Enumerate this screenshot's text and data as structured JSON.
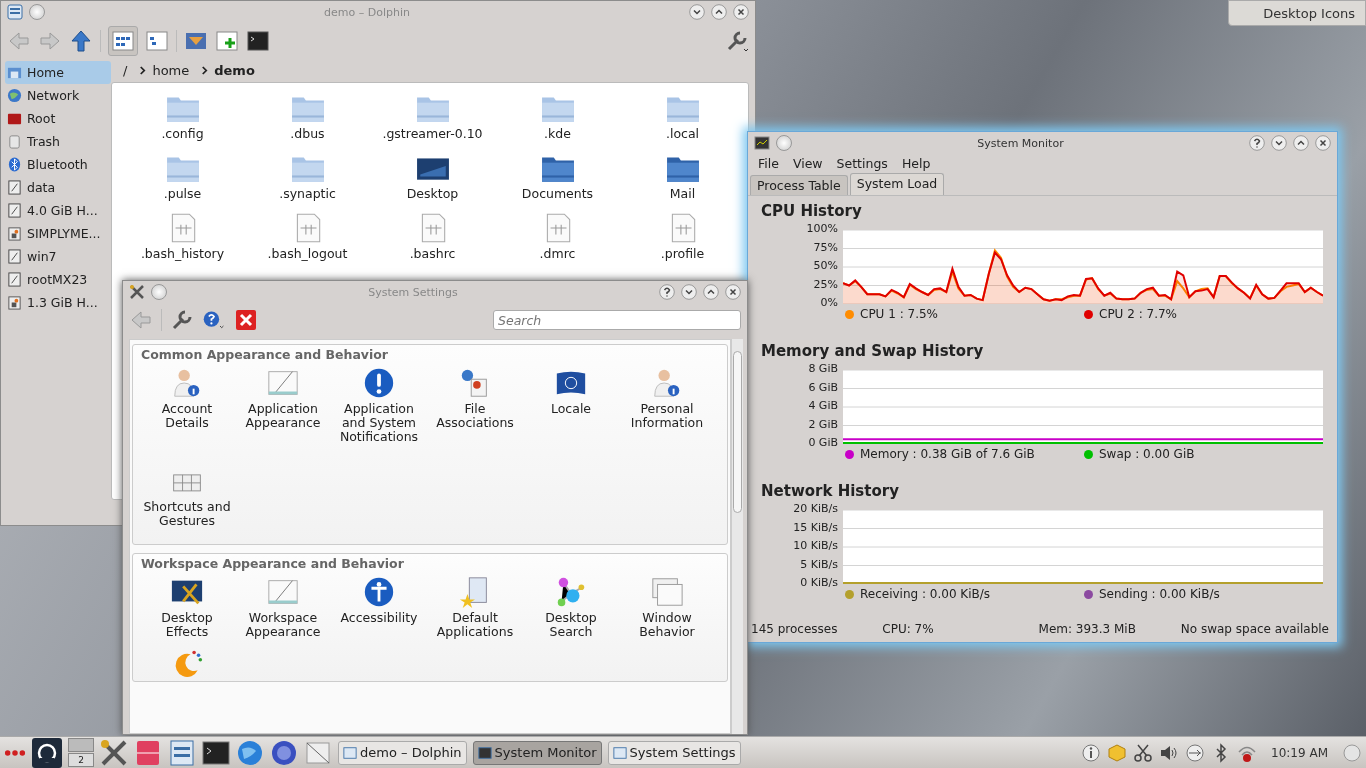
{
  "desktop_button": {
    "label": "Desktop Icons"
  },
  "dolphin": {
    "title": "demo – Dolphin",
    "breadcrumb": [
      {
        "label": "/",
        "current": false
      },
      {
        "label": "home",
        "current": false
      },
      {
        "label": "demo",
        "current": true
      }
    ],
    "places": [
      {
        "label": "Home",
        "selected": true
      },
      {
        "label": "Network",
        "selected": false
      },
      {
        "label": "Root",
        "selected": false
      },
      {
        "label": "Trash",
        "selected": false
      },
      {
        "label": "Bluetooth",
        "selected": false
      },
      {
        "label": "data",
        "selected": false
      },
      {
        "label": "4.0 GiB H...",
        "selected": false
      },
      {
        "label": "SIMPLYME...",
        "selected": false
      },
      {
        "label": "win7",
        "selected": false
      },
      {
        "label": "rootMX23",
        "selected": false
      },
      {
        "label": "1.3 GiB H...",
        "selected": false
      }
    ],
    "files": [
      {
        "name": ".config",
        "kind": "folder"
      },
      {
        "name": ".dbus",
        "kind": "folder"
      },
      {
        "name": ".gstreamer-0.10",
        "kind": "folder"
      },
      {
        "name": ".kde",
        "kind": "folder"
      },
      {
        "name": ".local",
        "kind": "folder"
      },
      {
        "name": ".pulse",
        "kind": "folder"
      },
      {
        "name": ".synaptic",
        "kind": "folder"
      },
      {
        "name": "Desktop",
        "kind": "desktop"
      },
      {
        "name": "Documents",
        "kind": "special"
      },
      {
        "name": "Mail",
        "kind": "special"
      },
      {
        "name": ".bash_history",
        "kind": "text"
      },
      {
        "name": ".bash_logout",
        "kind": "text"
      },
      {
        "name": ".bashrc",
        "kind": "text"
      },
      {
        "name": ".dmrc",
        "kind": "text"
      },
      {
        "name": ".profile",
        "kind": "text"
      }
    ]
  },
  "settings": {
    "title": "System Settings",
    "search": {
      "placeholder": "Search"
    },
    "sections": [
      {
        "title": "Common Appearance and Behavior",
        "items": [
          {
            "label": "Account Details"
          },
          {
            "label": "Application Appearance"
          },
          {
            "label": "Application and System Notifications"
          },
          {
            "label": "File Associations"
          },
          {
            "label": "Locale"
          },
          {
            "label": "Personal Information"
          },
          {
            "label": "Shortcuts and Gestures"
          }
        ]
      },
      {
        "title": "Workspace Appearance and Behavior",
        "items": [
          {
            "label": "Desktop Effects"
          },
          {
            "label": "Workspace Appearance"
          },
          {
            "label": "Accessibility"
          },
          {
            "label": "Default Applications"
          },
          {
            "label": "Desktop Search"
          },
          {
            "label": "Window Behavior"
          },
          {
            "kind": "icon-only"
          }
        ]
      }
    ]
  },
  "monitor": {
    "title": "System Monitor",
    "menu": [
      "File",
      "View",
      "Settings",
      "Help"
    ],
    "tabs": [
      {
        "label": "Process Table",
        "selected": false
      },
      {
        "label": "System Load",
        "selected": true
      }
    ],
    "panels": [
      {
        "title": "CPU History",
        "chart_data": {
          "type": "area",
          "grid": true,
          "ylim": [
            0,
            100
          ],
          "yticks": [
            {
              "value": 0,
              "label": "0%"
            },
            {
              "value": 25,
              "label": "25%"
            },
            {
              "value": 50,
              "label": "50%"
            },
            {
              "value": 75,
              "label": "75%"
            },
            {
              "value": 100,
              "label": "100%"
            }
          ],
          "series": [
            {
              "name": "CPU 1",
              "color": "#ff8c00",
              "values": [
                27,
                24,
                30,
                22,
                12,
                12,
                12,
                9,
                17,
                13,
                8,
                25,
                19,
                15,
                11,
                18,
                19,
                15,
                43,
                20,
                10,
                11,
                6,
                4,
                40,
                72,
                62,
                36,
                22,
                15,
                21,
                19,
                12,
                5,
                3,
                5,
                5,
                8,
                10,
                10,
                32,
                34,
                19,
                10,
                13,
                6,
                5,
                5,
                6,
                14,
                18,
                19,
                10,
                10,
                5,
                30,
                20,
                8,
                16,
                19,
                20,
                8,
                37,
                37,
                27,
                20,
                14,
                7,
                24,
                12,
                6,
                7,
                16,
                22,
                24,
                26,
                15,
                21,
                15,
                10
              ]
            },
            {
              "name": "CPU 2",
              "color": "#e00000",
              "values": [
                27,
                24,
                31,
                22,
                12,
                12,
                12,
                9,
                18,
                14,
                8,
                26,
                20,
                15,
                11,
                19,
                20,
                15,
                47,
                22,
                10,
                11,
                6,
                4,
                40,
                69,
                60,
                38,
                24,
                15,
                21,
                19,
                12,
                5,
                3,
                5,
                4,
                9,
                11,
                10,
                33,
                34,
                20,
                10,
                14,
                6,
                5,
                5,
                6,
                14,
                19,
                21,
                10,
                11,
                5,
                43,
                38,
                8,
                16,
                17,
                19,
                8,
                37,
                37,
                28,
                20,
                14,
                6,
                25,
                12,
                6,
                7,
                17,
                27,
                27,
                27,
                15,
                21,
                15,
                10
              ]
            }
          ]
        },
        "legend": [
          ": 7.5%",
          ": 7.7%"
        ]
      },
      {
        "title": "Memory and Swap History",
        "chart_data": {
          "type": "line",
          "grid": true,
          "ylim": [
            0,
            8
          ],
          "yticks": [
            {
              "value": 0,
              "label": "0 GiB"
            },
            {
              "value": 2,
              "label": "2 GiB"
            },
            {
              "value": 4,
              "label": "4 GiB"
            },
            {
              "value": 6,
              "label": "6 GiB"
            },
            {
              "value": 8,
              "label": "8 GiB"
            }
          ],
          "series": [
            {
              "name": "Memory",
              "color": "#c800c8",
              "values": [
                0.4,
                0.4,
                0.4,
                0.4
              ]
            },
            {
              "name": "Swap",
              "color": "#00c000",
              "values": [
                0,
                0,
                0,
                0
              ]
            }
          ]
        },
        "legend": [
          ": 0.38 GiB of 7.6 GiB",
          ": 0.00 GiB"
        ]
      },
      {
        "title": "Network History",
        "chart_data": {
          "type": "line",
          "grid": true,
          "ylim": [
            0,
            20
          ],
          "yticks": [
            {
              "value": 0,
              "label": "0 KiB/s"
            },
            {
              "value": 5,
              "label": "5 KiB/s"
            },
            {
              "value": 10,
              "label": "10 KiB/s"
            },
            {
              "value": 15,
              "label": "15 KiB/s"
            },
            {
              "value": 20,
              "label": "20 KiB/s"
            }
          ],
          "series": [
            {
              "name": "Receiving",
              "color": "#b4a02c",
              "values": [
                0,
                0,
                0,
                0
              ]
            },
            {
              "name": "Sending",
              "color": "#8c4aa0",
              "values": [
                null,
                null,
                null,
                null
              ]
            }
          ]
        },
        "legend": [
          ": 0.00 KiB/s",
          ": 0.00 KiB/s"
        ]
      }
    ],
    "status": [
      "145 processes",
      "CPU: 7%",
      "Mem: 393.3 MiB",
      "No swap space available"
    ]
  },
  "taskbar": {
    "pager": "2",
    "tasks": [
      {
        "label": "demo – Dolphin",
        "selected": false
      },
      {
        "label": "System Monitor",
        "selected": true
      },
      {
        "label": "System Settings",
        "selected": false
      }
    ],
    "clock": "10:19 AM"
  }
}
